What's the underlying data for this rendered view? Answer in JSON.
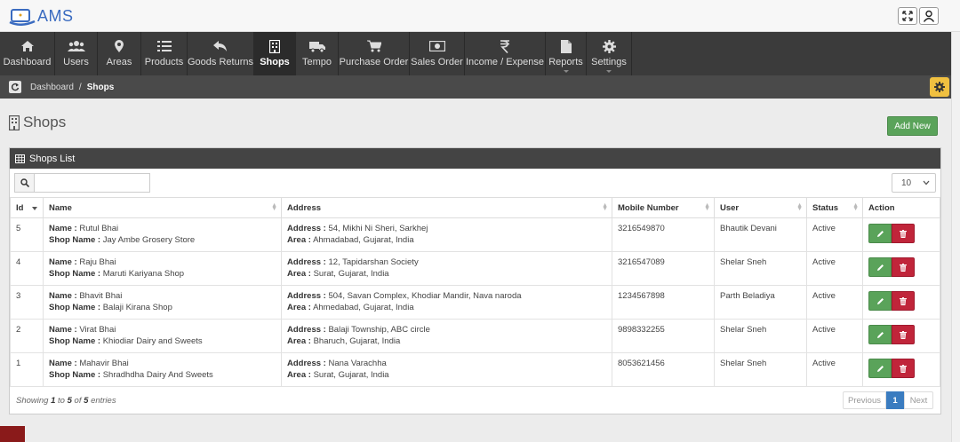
{
  "app": {
    "title": "AMS"
  },
  "nav": [
    {
      "label": "Dashboard",
      "icon": "home-icon"
    },
    {
      "label": "Users",
      "icon": "users-icon"
    },
    {
      "label": "Areas",
      "icon": "map-marker-icon"
    },
    {
      "label": "Products",
      "icon": "list-icon"
    },
    {
      "label": "Goods Returns",
      "icon": "reply-icon"
    },
    {
      "label": "Shops",
      "icon": "building-icon",
      "active": true
    },
    {
      "label": "Tempo",
      "icon": "truck-icon"
    },
    {
      "label": "Purchase Order",
      "icon": "cart-icon"
    },
    {
      "label": "Sales Order",
      "icon": "money-icon"
    },
    {
      "label": "Income / Expense",
      "icon": "rupee-icon"
    },
    {
      "label": "Reports",
      "icon": "file-icon",
      "dropdown": true
    },
    {
      "label": "Settings",
      "icon": "gear-icon",
      "dropdown": true
    }
  ],
  "breadcrumb": {
    "home": "Dashboard",
    "sep": "/",
    "current": "Shops"
  },
  "page": {
    "title": "Shops",
    "add_label": "Add New"
  },
  "panel": {
    "title": "Shops List",
    "search_value": "",
    "page_length": "10"
  },
  "table": {
    "columns": [
      "Id",
      "Name",
      "Address",
      "Mobile Number",
      "User",
      "Status",
      "Action"
    ],
    "name_label": "Name :",
    "shop_label": "Shop Name :",
    "address_label": "Address :",
    "area_label": "Area :",
    "rows": [
      {
        "id": "5",
        "name": "Rutul Bhai",
        "shop": "Jay Ambe Grosery Store",
        "address": "54, Mikhi Ni Sheri, Sarkhej",
        "area": "Ahmadabad, Gujarat, India",
        "mobile": "3216549870",
        "user": "Bhautik Devani",
        "status": "Active"
      },
      {
        "id": "4",
        "name": "Raju Bhai",
        "shop": "Maruti Kariyana Shop",
        "address": "12, Tapidarshan Society",
        "area": "Surat, Gujarat, India",
        "mobile": "3216547089",
        "user": "Shelar Sneh",
        "status": "Active"
      },
      {
        "id": "3",
        "name": "Bhavit Bhai",
        "shop": "Balaji Kirana Shop",
        "address": "504, Savan Complex, Khodiar Mandir, Nava naroda",
        "area": "Ahmedabad, Gujarat, India",
        "mobile": "1234567898",
        "user": "Parth Beladiya",
        "status": "Active"
      },
      {
        "id": "2",
        "name": "Virat Bhai",
        "shop": "Khiodiar Dairy and Sweets",
        "address": "Balaji Township, ABC circle",
        "area": "Bharuch, Gujarat, India",
        "mobile": "9898332255",
        "user": "Shelar Sneh",
        "status": "Active"
      },
      {
        "id": "1",
        "name": "Mahavir Bhai",
        "shop": "Shradhdha Dairy And Sweets",
        "address": "Nana Varachha",
        "area": "Surat, Gujarat, India",
        "mobile": "8053621456",
        "user": "Shelar Sneh",
        "status": "Active"
      }
    ]
  },
  "footer": {
    "showing": "Showing",
    "from": "1",
    "to_word": "to",
    "to": "5",
    "of_word": "of",
    "total": "5",
    "entries": "entries",
    "prev": "Previous",
    "page": "1",
    "next": "Next"
  },
  "colors": {
    "nav_bg": "#3b3b3b",
    "accent_green": "#5aa35a",
    "danger_red": "#c0253a",
    "page_active": "#3a7cc0"
  }
}
